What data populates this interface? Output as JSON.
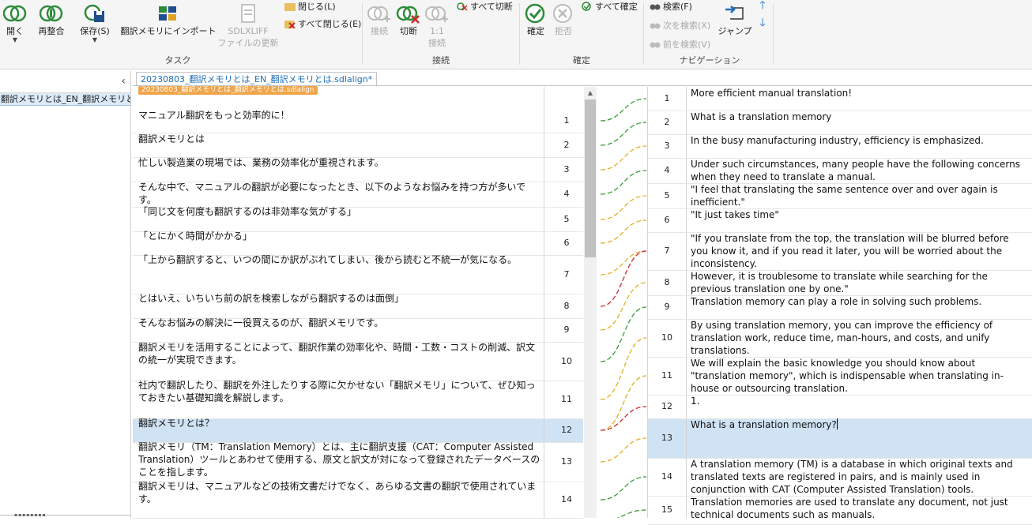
{
  "ribbon": {
    "open": "開く",
    "reorganize": "再整合",
    "save": "保存(S)",
    "import_tm": "翻訳メモリにインポート",
    "sdlxliff_update_1": "SDLXLIFF",
    "sdlxliff_update_2": "ファイルの更新",
    "close": "閉じる(L)",
    "close_all": "すべて閉じる(E)",
    "task_group": "タスク",
    "connect": "接続",
    "disconnect": "切断",
    "one_to_one_1": "1:1",
    "one_to_one_2": "接続",
    "disconnect_all": "すべて切断",
    "connect_group": "接続",
    "confirm": "確定",
    "reject": "拒否",
    "confirm_all": "すべて確定",
    "confirm_group": "確定",
    "search": "検索(F)",
    "search_next": "次を検索(X)",
    "search_prev": "前を検索(V)",
    "jump": "ジャンプ",
    "nav_group": "ナビゲーション"
  },
  "left_panel": {
    "item": "翻訳メモリとは_EN_翻訳メモリとは.",
    "collapse": "‹"
  },
  "doc_tab": {
    "title": "20230803_翻訳メモリとは_EN_翻訳メモリとは.sdlalign*",
    "source_file": "20230803_翻訳メモリとは_翻訳メモリとは.sdlalign"
  },
  "source_segments": [
    {
      "num": "1",
      "text": "マニュアル翻訳をもっと効率的に！"
    },
    {
      "num": "2",
      "text": "翻訳メモリとは"
    },
    {
      "num": "3",
      "text": "忙しい製造業の現場では、業務の効率化が重視されます。"
    },
    {
      "num": "4",
      "text": "そんな中で、マニュアルの翻訳が必要になったとき、以下のようなお悩みを持つ方が多いです。"
    },
    {
      "num": "5",
      "text": "「同じ文を何度も翻訳するのは非効率な気がする」"
    },
    {
      "num": "6",
      "text": "「とにかく時間がかかる」"
    },
    {
      "num": "7",
      "text": "「上から翻訳すると、いつの間にか訳がぶれてしまい、後から読むと不統一が気になる。"
    },
    {
      "num": "8",
      "text": "とはいえ、いちいち前の訳を検索しながら翻訳するのは面倒」"
    },
    {
      "num": "9",
      "text": "そんなお悩みの解決に一役買えるのが、翻訳メモリです。"
    },
    {
      "num": "10",
      "text": "翻訳メモリを活用することによって、翻訳作業の効率化や、時間・工数・コストの削減、訳文の統一が実現できます。"
    },
    {
      "num": "11",
      "text": "社内で翻訳したり、翻訳を外注したりする際に欠かせない「翻訳メモリ」について、ぜひ知っておきたい基礎知識を解説します。"
    },
    {
      "num": "12",
      "text": "翻訳メモリとは？"
    },
    {
      "num": "13",
      "text": "翻訳メモリ（TM：Translation Memory）とは、主に翻訳支援（CAT：Computer Assisted Translation）ツールとあわせて使用する、原文と訳文が対になって登録されたデータベースのことを指します。"
    },
    {
      "num": "14",
      "text": "翻訳メモリは、マニュアルなどの技術文書だけでなく、あらゆる文書の翻訳で使用されています。"
    }
  ],
  "target_segments": [
    {
      "num": "1",
      "text": "More efficient manual translation!"
    },
    {
      "num": "2",
      "text": "What is a translation memory"
    },
    {
      "num": "3",
      "text": "In the busy manufacturing industry, efficiency is emphasized."
    },
    {
      "num": "4",
      "text": "Under such circumstances, many people have the following concerns when they need to translate a manual."
    },
    {
      "num": "5",
      "text": "\"I feel that translating the same sentence over and over again is inefficient.\""
    },
    {
      "num": "6",
      "text": "\"It just takes time\""
    },
    {
      "num": "7",
      "text": "\"If you translate from the top, the translation will be blurred before you know it, and if you read it later, you will be worried about the inconsistency."
    },
    {
      "num": "8",
      "text": "However, it is troublesome to translate while searching for the previous translation one by one.\""
    },
    {
      "num": "9",
      "text": "Translation memory can play a role in solving such problems."
    },
    {
      "num": "10",
      "text": "By using translation memory, you can improve the efficiency of translation work, reduce time, man-hours, and costs, and unify translations."
    },
    {
      "num": "11",
      "text": "We will explain the basic knowledge you should know about \"translation memory\", which is indispensable when translating in-house or outsourcing translation."
    },
    {
      "num": "12",
      "text": "1."
    },
    {
      "num": "13",
      "text": "What is a translation memory?"
    },
    {
      "num": "14",
      "text": "A translation memory (TM) is a database in which original texts and translated texts are registered in pairs, and is mainly used in conjunction with CAT (Computer Assisted Translation) tools."
    },
    {
      "num": "15",
      "text": "Translation memories are used to translate any document, not just technical documents such as manuals."
    }
  ],
  "link_colors": {
    "green": "#3a9a3a",
    "yellow": "#e0b020",
    "red": "#c82828",
    "selected_row": "#cfe3f4"
  }
}
